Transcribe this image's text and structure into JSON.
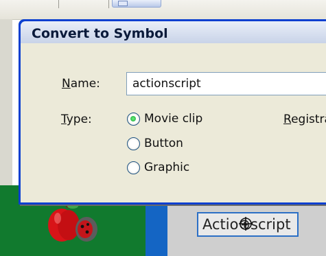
{
  "dialog": {
    "title": "Convert to Symbol",
    "name_label": "Name:",
    "name_value": "actionscript",
    "type_label": "Type:",
    "registration_label": "Registrā",
    "type_options": [
      {
        "label": "Movie clip",
        "checked": true
      },
      {
        "label": "Button",
        "checked": false
      },
      {
        "label": "Graphic",
        "checked": false
      }
    ]
  },
  "stage": {
    "symbol_text": "Actio⊕script"
  },
  "icons": [
    "apple-ladybug-graphic",
    "crosshair-cursor-icon",
    "dropdown-arrow-icon"
  ],
  "colors": {
    "title_bar": "#0a3fd0",
    "dialog_face": "#ecead9",
    "stage_green": "#117a2e",
    "stage_blue": "#1465c4",
    "radio_checked": "#19a13a"
  }
}
